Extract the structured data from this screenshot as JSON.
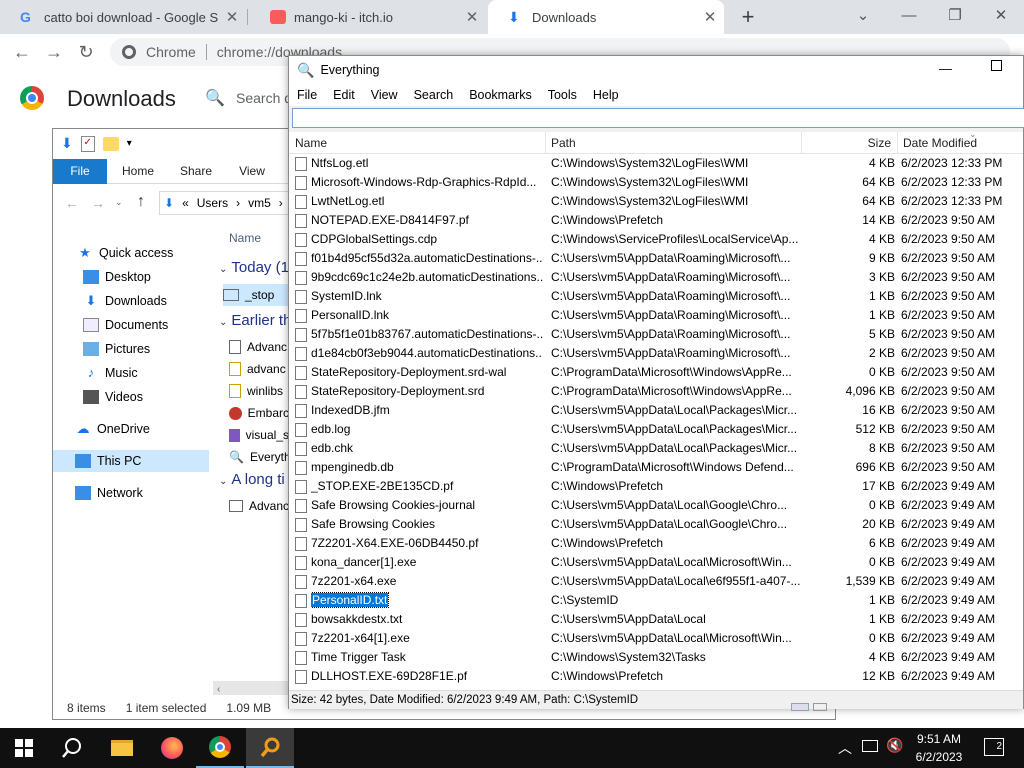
{
  "chrome": {
    "tabs": [
      {
        "title": "catto boi download - Google Sea",
        "icon": "google-icon"
      },
      {
        "title": "mango-ki - itch.io",
        "icon": "itchio-icon"
      },
      {
        "title": "Downloads",
        "icon": "download-icon"
      }
    ],
    "new_tab": "+",
    "omnibox_label": "Chrome",
    "url": "chrome://downloads",
    "page_title": "Downloads",
    "search_placeholder": "Search d"
  },
  "explorer": {
    "ribbon_tabs": [
      "File",
      "Home",
      "Share",
      "View"
    ],
    "breadcrumb": [
      "«",
      "Users",
      "›",
      "vm5",
      "›"
    ],
    "column_name": "Name",
    "nav": {
      "quick_access": "Quick access",
      "desktop": "Desktop",
      "downloads": "Downloads",
      "documents": "Documents",
      "pictures": "Pictures",
      "music": "Music",
      "videos": "Videos",
      "onedrive": "OneDrive",
      "this_pc": "This PC",
      "network": "Network"
    },
    "groups": [
      "Today (1",
      "Earlier th",
      "A long ti"
    ],
    "items": [
      "_stop",
      "Advanc",
      "advanc",
      "winlibs",
      "Embarc",
      "visual_s",
      "Everyth",
      "Advanc"
    ],
    "status": {
      "count": "8 items",
      "selected": "1 item selected",
      "size": "1.09 MB"
    }
  },
  "everything": {
    "title": "Everything",
    "menu": [
      "File",
      "Edit",
      "View",
      "Search",
      "Bookmarks",
      "Tools",
      "Help"
    ],
    "search_value": "",
    "columns": {
      "name": "Name",
      "path": "Path",
      "size": "Size",
      "date": "Date Modified"
    },
    "rows": [
      {
        "name": "NtfsLog.etl",
        "path": "C:\\Windows\\System32\\LogFiles\\WMI",
        "size": "4 KB",
        "date": "6/2/2023 12:33 PM"
      },
      {
        "name": "Microsoft-Windows-Rdp-Graphics-RdpId...",
        "path": "C:\\Windows\\System32\\LogFiles\\WMI",
        "size": "64 KB",
        "date": "6/2/2023 12:33 PM"
      },
      {
        "name": "LwtNetLog.etl",
        "path": "C:\\Windows\\System32\\LogFiles\\WMI",
        "size": "64 KB",
        "date": "6/2/2023 12:33 PM"
      },
      {
        "name": "NOTEPAD.EXE-D8414F97.pf",
        "path": "C:\\Windows\\Prefetch",
        "size": "14 KB",
        "date": "6/2/2023 9:50 AM"
      },
      {
        "name": "CDPGlobalSettings.cdp",
        "path": "C:\\Windows\\ServiceProfiles\\LocalService\\Ap...",
        "size": "4 KB",
        "date": "6/2/2023 9:50 AM"
      },
      {
        "name": "f01b4d95cf55d32a.automaticDestinations-...",
        "path": "C:\\Users\\vm5\\AppData\\Roaming\\Microsoft\\...",
        "size": "9 KB",
        "date": "6/2/2023 9:50 AM"
      },
      {
        "name": "9b9cdc69c1c24e2b.automaticDestinations...",
        "path": "C:\\Users\\vm5\\AppData\\Roaming\\Microsoft\\...",
        "size": "3 KB",
        "date": "6/2/2023 9:50 AM"
      },
      {
        "name": "SystemID.lnk",
        "path": "C:\\Users\\vm5\\AppData\\Roaming\\Microsoft\\...",
        "size": "1 KB",
        "date": "6/2/2023 9:50 AM"
      },
      {
        "name": "PersonalID.lnk",
        "path": "C:\\Users\\vm5\\AppData\\Roaming\\Microsoft\\...",
        "size": "1 KB",
        "date": "6/2/2023 9:50 AM"
      },
      {
        "name": "5f7b5f1e01b83767.automaticDestinations-...",
        "path": "C:\\Users\\vm5\\AppData\\Roaming\\Microsoft\\...",
        "size": "5 KB",
        "date": "6/2/2023 9:50 AM"
      },
      {
        "name": "d1e84cb0f3eb9044.automaticDestinations...",
        "path": "C:\\Users\\vm5\\AppData\\Roaming\\Microsoft\\...",
        "size": "2 KB",
        "date": "6/2/2023 9:50 AM"
      },
      {
        "name": "StateRepository-Deployment.srd-wal",
        "path": "C:\\ProgramData\\Microsoft\\Windows\\AppRe...",
        "size": "0 KB",
        "date": "6/2/2023 9:50 AM"
      },
      {
        "name": "StateRepository-Deployment.srd",
        "path": "C:\\ProgramData\\Microsoft\\Windows\\AppRe...",
        "size": "4,096 KB",
        "date": "6/2/2023 9:50 AM"
      },
      {
        "name": "IndexedDB.jfm",
        "path": "C:\\Users\\vm5\\AppData\\Local\\Packages\\Micr...",
        "size": "16 KB",
        "date": "6/2/2023 9:50 AM"
      },
      {
        "name": "edb.log",
        "path": "C:\\Users\\vm5\\AppData\\Local\\Packages\\Micr...",
        "size": "512 KB",
        "date": "6/2/2023 9:50 AM"
      },
      {
        "name": "edb.chk",
        "path": "C:\\Users\\vm5\\AppData\\Local\\Packages\\Micr...",
        "size": "8 KB",
        "date": "6/2/2023 9:50 AM"
      },
      {
        "name": "mpenginedb.db",
        "path": "C:\\ProgramData\\Microsoft\\Windows Defend...",
        "size": "696 KB",
        "date": "6/2/2023 9:50 AM"
      },
      {
        "name": "_STOP.EXE-2BE135CD.pf",
        "path": "C:\\Windows\\Prefetch",
        "size": "17 KB",
        "date": "6/2/2023 9:49 AM"
      },
      {
        "name": "Safe Browsing Cookies-journal",
        "path": "C:\\Users\\vm5\\AppData\\Local\\Google\\Chro...",
        "size": "0 KB",
        "date": "6/2/2023 9:49 AM"
      },
      {
        "name": "Safe Browsing Cookies",
        "path": "C:\\Users\\vm5\\AppData\\Local\\Google\\Chro...",
        "size": "20 KB",
        "date": "6/2/2023 9:49 AM"
      },
      {
        "name": "7Z2201-X64.EXE-06DB4450.pf",
        "path": "C:\\Windows\\Prefetch",
        "size": "6 KB",
        "date": "6/2/2023 9:49 AM"
      },
      {
        "name": "kona_dancer[1].exe",
        "path": "C:\\Users\\vm5\\AppData\\Local\\Microsoft\\Win...",
        "size": "0 KB",
        "date": "6/2/2023 9:49 AM"
      },
      {
        "name": "7z2201-x64.exe",
        "path": "C:\\Users\\vm5\\AppData\\Local\\e6f955f1-a407-...",
        "size": "1,539 KB",
        "date": "6/2/2023 9:49 AM"
      },
      {
        "name": "PersonalID.txt",
        "path": "C:\\SystemID",
        "size": "1 KB",
        "date": "6/2/2023 9:49 AM"
      },
      {
        "name": "bowsakkdestx.txt",
        "path": "C:\\Users\\vm5\\AppData\\Local",
        "size": "1 KB",
        "date": "6/2/2023 9:49 AM"
      },
      {
        "name": "7z2201-x64[1].exe",
        "path": "C:\\Users\\vm5\\AppData\\Local\\Microsoft\\Win...",
        "size": "0 KB",
        "date": "6/2/2023 9:49 AM"
      },
      {
        "name": "Time Trigger Task",
        "path": "C:\\Windows\\System32\\Tasks",
        "size": "4 KB",
        "date": "6/2/2023 9:49 AM"
      },
      {
        "name": "DLLHOST.EXE-69D28F1E.pf",
        "path": "C:\\Windows\\Prefetch",
        "size": "12 KB",
        "date": "6/2/2023 9:49 AM"
      }
    ],
    "selected_row": "PersonalID.txt",
    "status": "Size: 42 bytes, Date Modified: 6/2/2023 9:49 AM, Path: C:\\SystemID"
  },
  "taskbar": {
    "time": "9:51 AM",
    "date": "6/2/2023",
    "notification_count": "2"
  }
}
